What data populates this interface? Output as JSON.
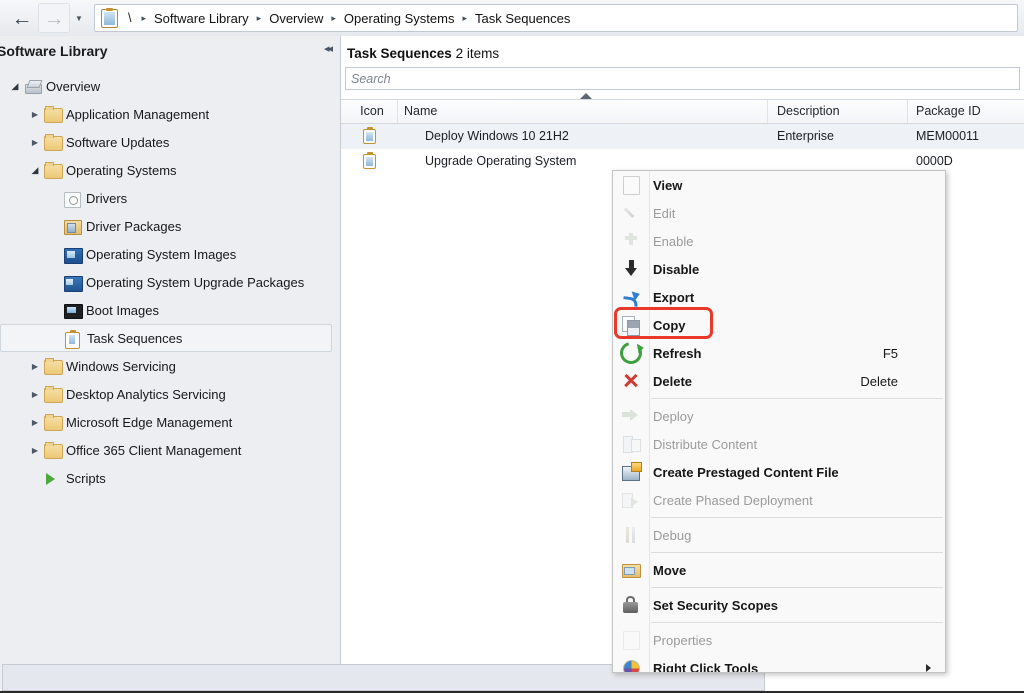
{
  "topbar": {
    "back_icon": "arrow-left-icon",
    "forward_icon": "arrow-right-icon",
    "dropdown_icon": "chevron-down-icon",
    "root_label": "\\",
    "separator": "▸",
    "breadcrumbs": [
      {
        "label": "Software Library"
      },
      {
        "label": "Overview"
      },
      {
        "label": "Operating Systems"
      },
      {
        "label": "Task Sequences"
      }
    ]
  },
  "sidebar": {
    "title": "Software Library",
    "collapse_icon": "chevron-double-left-icon",
    "items": [
      {
        "label": "Overview",
        "icon": "overview-icon",
        "indent": 0,
        "twisty": "open",
        "selected": false
      },
      {
        "label": "Application Management",
        "icon": "folder-icon",
        "indent": 1,
        "twisty": "closed",
        "selected": false
      },
      {
        "label": "Software Updates",
        "icon": "folder-icon",
        "indent": 1,
        "twisty": "closed",
        "selected": false
      },
      {
        "label": "Operating Systems",
        "icon": "folder-icon",
        "indent": 1,
        "twisty": "open",
        "selected": false
      },
      {
        "label": "Drivers",
        "icon": "drivers-icon",
        "indent": 2,
        "twisty": "none",
        "selected": false
      },
      {
        "label": "Driver Packages",
        "icon": "driver-package-icon",
        "indent": 2,
        "twisty": "none",
        "selected": false
      },
      {
        "label": "Operating System Images",
        "icon": "os-image-icon",
        "indent": 2,
        "twisty": "none",
        "selected": false
      },
      {
        "label": "Operating System Upgrade Packages",
        "icon": "os-upgrade-icon",
        "indent": 2,
        "twisty": "none",
        "selected": false
      },
      {
        "label": "Boot Images",
        "icon": "boot-image-icon",
        "indent": 2,
        "twisty": "none",
        "selected": false
      },
      {
        "label": "Task Sequences",
        "icon": "task-sequence-icon",
        "indent": 2,
        "twisty": "none",
        "selected": true
      },
      {
        "label": "Windows Servicing",
        "icon": "folder-icon",
        "indent": 1,
        "twisty": "closed",
        "selected": false
      },
      {
        "label": "Desktop Analytics Servicing",
        "icon": "folder-icon",
        "indent": 1,
        "twisty": "closed",
        "selected": false
      },
      {
        "label": "Microsoft Edge Management",
        "icon": "folder-icon",
        "indent": 1,
        "twisty": "closed",
        "selected": false
      },
      {
        "label": "Office 365 Client Management",
        "icon": "folder-icon",
        "indent": 1,
        "twisty": "closed",
        "selected": false
      },
      {
        "label": "Scripts",
        "icon": "script-icon",
        "indent": 1,
        "twisty": "none",
        "selected": false
      }
    ]
  },
  "main": {
    "title_name": "Task Sequences",
    "title_count": " 2 items",
    "search_placeholder": "Search",
    "columns": [
      {
        "label": "Icon"
      },
      {
        "label": "Name"
      },
      {
        "label": "Description"
      },
      {
        "label": "Package ID"
      }
    ],
    "sort_indicator": "ascending-sort-arrow",
    "rows": [
      {
        "icon": "task-sequence-icon",
        "name": "Deploy Windows 10 21H2",
        "description": "Enterprise",
        "package_id": "MEM00011",
        "selected": true
      },
      {
        "icon": "task-sequence-icon",
        "name": "Upgrade Operating System",
        "description": "",
        "package_id": "0000D",
        "selected": false
      }
    ]
  },
  "context_menu": {
    "highlight_color": "#e8392b",
    "highlighted_item": "Copy",
    "items": [
      {
        "type": "item",
        "label": "View",
        "icon": "view-icon",
        "enabled": true,
        "accel": ""
      },
      {
        "type": "item",
        "label": "Edit",
        "icon": "edit-pencil-icon",
        "enabled": false,
        "accel": ""
      },
      {
        "type": "item",
        "label": "Enable",
        "icon": "enable-icon",
        "enabled": false,
        "accel": ""
      },
      {
        "type": "item",
        "label": "Disable",
        "icon": "disable-icon",
        "enabled": true,
        "accel": ""
      },
      {
        "type": "item",
        "label": "Export",
        "icon": "export-icon",
        "enabled": true,
        "accel": ""
      },
      {
        "type": "item",
        "label": "Copy",
        "icon": "copy-icon",
        "enabled": true,
        "accel": ""
      },
      {
        "type": "item",
        "label": "Refresh",
        "icon": "refresh-icon",
        "enabled": true,
        "accel": "F5"
      },
      {
        "type": "item",
        "label": "Delete",
        "icon": "delete-x-icon",
        "enabled": true,
        "accel": "Delete"
      },
      {
        "type": "separator"
      },
      {
        "type": "item",
        "label": "Deploy",
        "icon": "deploy-icon",
        "enabled": false,
        "accel": ""
      },
      {
        "type": "item",
        "label": "Distribute Content",
        "icon": "distribute-content-icon",
        "enabled": false,
        "accel": ""
      },
      {
        "type": "item",
        "label": "Create Prestaged Content File",
        "icon": "prestaged-content-icon",
        "enabled": true,
        "accel": ""
      },
      {
        "type": "item",
        "label": "Create Phased Deployment",
        "icon": "phased-deployment-icon",
        "enabled": false,
        "accel": ""
      },
      {
        "type": "separator"
      },
      {
        "type": "item",
        "label": "Debug",
        "icon": "debug-icon",
        "enabled": false,
        "accel": ""
      },
      {
        "type": "separator"
      },
      {
        "type": "item",
        "label": "Move",
        "icon": "move-folder-icon",
        "enabled": true,
        "accel": ""
      },
      {
        "type": "separator"
      },
      {
        "type": "item",
        "label": "Set Security Scopes",
        "icon": "security-lock-icon",
        "enabled": true,
        "accel": ""
      },
      {
        "type": "separator"
      },
      {
        "type": "item",
        "label": "Properties",
        "icon": "properties-icon",
        "enabled": false,
        "accel": ""
      },
      {
        "type": "item",
        "label": "Right Click Tools",
        "icon": "right-click-tools-icon",
        "enabled": true,
        "accel": "",
        "submenu": true
      }
    ]
  }
}
